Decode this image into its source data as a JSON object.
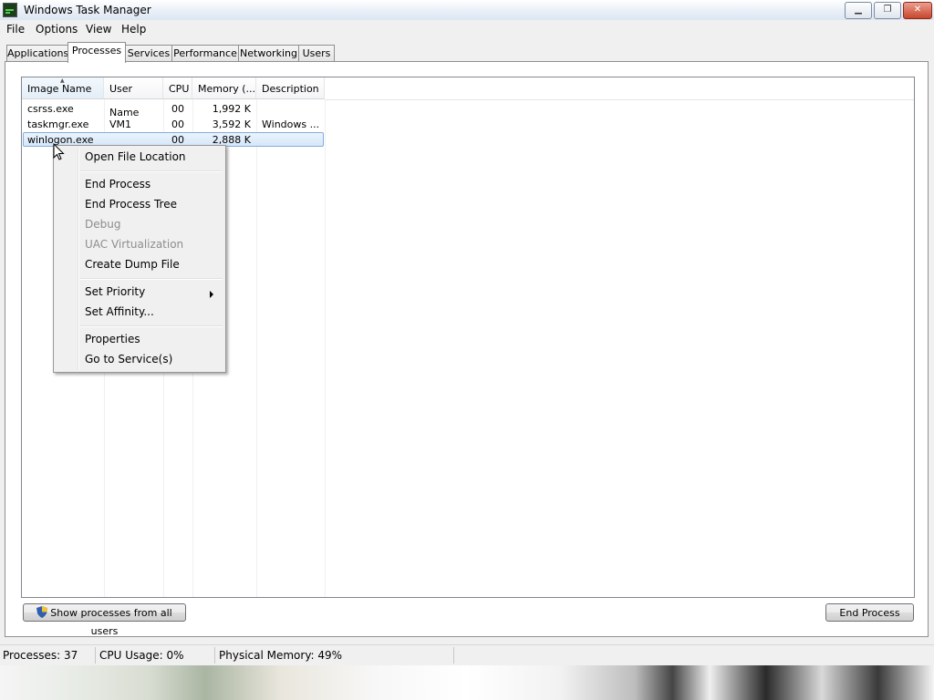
{
  "window": {
    "title": "Windows Task Manager"
  },
  "menu": [
    "File",
    "Options",
    "View",
    "Help"
  ],
  "tabs": [
    "Applications",
    "Processes",
    "Services",
    "Performance",
    "Networking",
    "Users"
  ],
  "active_tab": "Processes",
  "columns": [
    "Image Name",
    "User Name",
    "CPU",
    "Memory (...",
    "Description"
  ],
  "rows": [
    {
      "image": "csrss.exe",
      "user": "",
      "cpu": "00",
      "memory": "1,992 K",
      "description": ""
    },
    {
      "image": "taskmgr.exe",
      "user": "VM1",
      "cpu": "00",
      "memory": "3,592 K",
      "description": "Windows ..."
    },
    {
      "image": "winlogon.exe",
      "user": "",
      "cpu": "00",
      "memory": "2,888 K",
      "description": ""
    }
  ],
  "context_menu": {
    "items": [
      {
        "label": "Open File Location",
        "enabled": true
      },
      {
        "label": "End Process",
        "enabled": true
      },
      {
        "label": "End Process Tree",
        "enabled": true
      },
      {
        "label": "Debug",
        "enabled": false
      },
      {
        "label": "UAC Virtualization",
        "enabled": false
      },
      {
        "label": "Create Dump File",
        "enabled": true
      },
      {
        "label": "Set Priority",
        "enabled": true
      },
      {
        "label": "Set Affinity...",
        "enabled": true
      },
      {
        "label": "Properties",
        "enabled": true
      },
      {
        "label": "Go to Service(s)",
        "enabled": true
      }
    ]
  },
  "buttons": {
    "show_all_users": "Show processes from all users",
    "end_process": "End Process"
  },
  "status": {
    "processes": "Processes: 37",
    "cpu": "CPU Usage: 0%",
    "memory": "Physical Memory: 49%"
  }
}
